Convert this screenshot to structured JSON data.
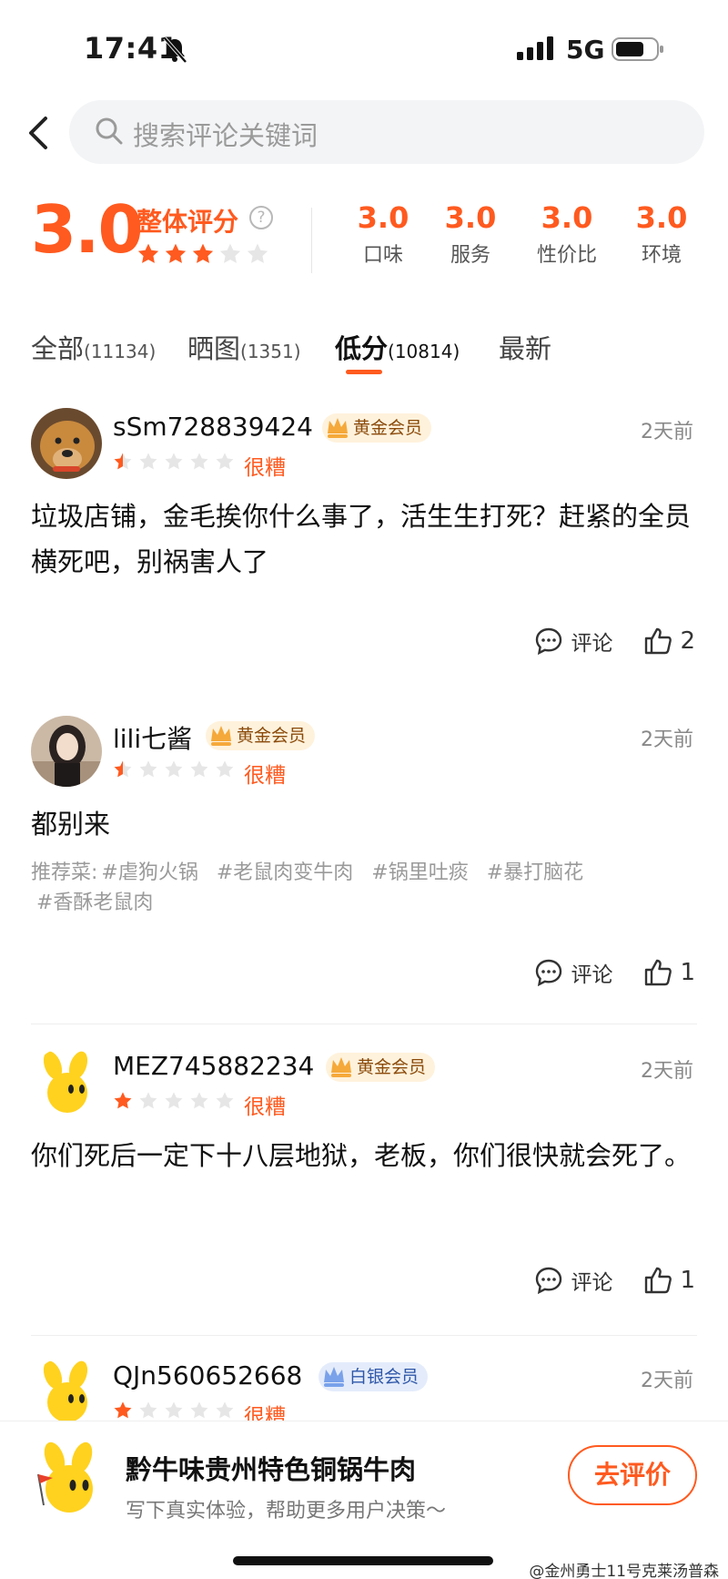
{
  "status": {
    "time": "17:41",
    "network": "5G"
  },
  "search": {
    "placeholder": "搜索评论关键词"
  },
  "rating": {
    "overall_score": "3.0",
    "overall_label": "整体评分",
    "overall_stars": 3,
    "sub_scores": [
      {
        "value": "3.0",
        "label": "口味"
      },
      {
        "value": "3.0",
        "label": "服务"
      },
      {
        "value": "3.0",
        "label": "性价比"
      },
      {
        "value": "3.0",
        "label": "环境"
      }
    ]
  },
  "tabs": [
    {
      "label": "全部",
      "count": "(11134)",
      "active": false
    },
    {
      "label": "晒图",
      "count": "(1351)",
      "active": false
    },
    {
      "label": "低分",
      "count": "(10814)",
      "active": true
    },
    {
      "label": "最新",
      "count": "",
      "active": false
    }
  ],
  "reviews": [
    {
      "username": "sSm728839424",
      "member_badge": "黄金会员",
      "time": "2天前",
      "stars": 0.5,
      "rating_text": "很糟",
      "content": "垃圾店铺，金毛挨你什么事了，活生生打死？赶紧的全员横死吧，别祸害人了",
      "comment_label": "评论",
      "likes": "2"
    },
    {
      "username": "lili七酱",
      "member_badge": "黄金会员",
      "time": "2天前",
      "stars": 0.5,
      "rating_text": "很糟",
      "content": "都别来",
      "recommended_label": "推荐菜:",
      "recommended_dishes": [
        "#虐狗火锅",
        "#老鼠肉变牛肉",
        "#锅里吐痰",
        "#暴打脑花",
        "#香酥老鼠肉"
      ],
      "comment_label": "评论",
      "likes": "1"
    },
    {
      "username": "MEZ745882234",
      "member_badge": "黄金会员",
      "time": "2天前",
      "stars": 1,
      "rating_text": "很糟",
      "content": "你们死后一定下十八层地狱，老板，你们很快就会死了。",
      "comment_label": "评论",
      "likes": "1"
    },
    {
      "username": "QJn560652668",
      "member_badge": "白银会员",
      "time": "2天前",
      "stars": 1,
      "rating_text": "很糟"
    }
  ],
  "bottom": {
    "shop_name": "黔牛味贵州特色铜锅牛肉",
    "hint": "写下真实体验，帮助更多用户决策～",
    "button": "去评价",
    "watermark": "@金州勇士11号克莱汤普森"
  },
  "colors": {
    "accent": "#ff5a1f",
    "gold_badge_bg": "#fff2dc",
    "silver_badge_bg": "#e4ecfb"
  }
}
